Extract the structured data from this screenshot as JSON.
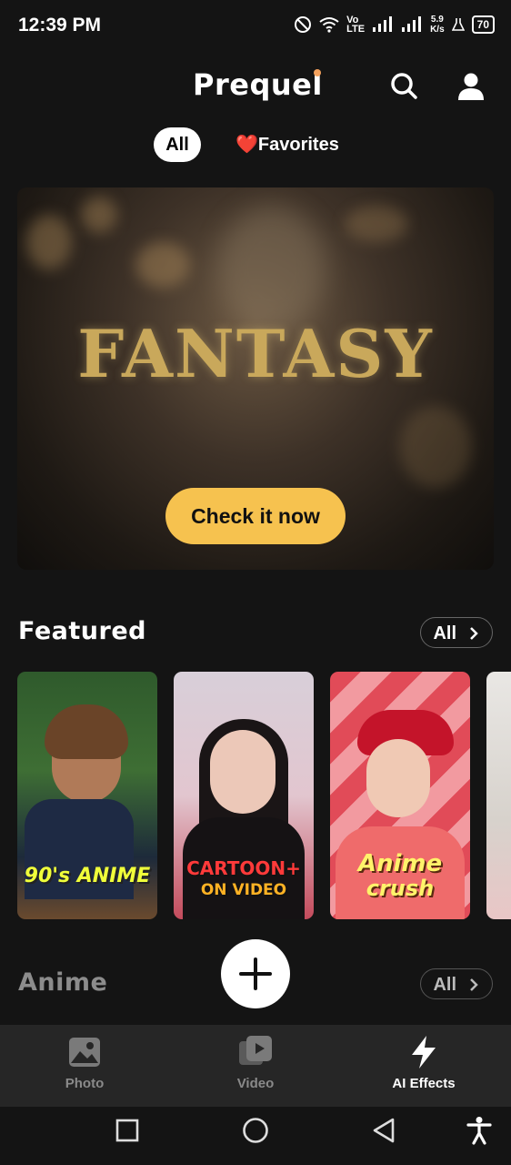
{
  "status_bar": {
    "time": "12:39 PM",
    "net_speed": "5.9",
    "net_unit": "K/s",
    "lte_top": "Vo",
    "lte_bottom": "LTE",
    "battery": "70"
  },
  "header": {
    "logo": "Prequel",
    "accent": "#f5a25d"
  },
  "filters": {
    "all": "All",
    "favorites": "Favorites",
    "heart": "❤️"
  },
  "hero": {
    "title": "FANTASY",
    "cta": "Check it now",
    "cta_color": "#f6c24f"
  },
  "featured": {
    "title": "Featured",
    "all_label": "All",
    "cards": [
      {
        "label": "90's ANIME"
      },
      {
        "label_line1": "CARTOON+",
        "label_line2": "ON VIDEO"
      },
      {
        "label_line1": "Anime",
        "label_line2": "crush"
      }
    ]
  },
  "anime": {
    "title": "Anime",
    "all_label": "All"
  },
  "bottom_nav": {
    "items": [
      {
        "label": "Photo",
        "icon": "photo-icon",
        "active": false
      },
      {
        "label": "Video",
        "icon": "video-icon",
        "active": false
      },
      {
        "label": "AI Effects",
        "icon": "lightning-icon",
        "active": true
      }
    ]
  },
  "system_nav": {
    "icons": [
      "recents-square-icon",
      "home-circle-icon",
      "back-triangle-icon",
      "accessibility-icon"
    ]
  }
}
